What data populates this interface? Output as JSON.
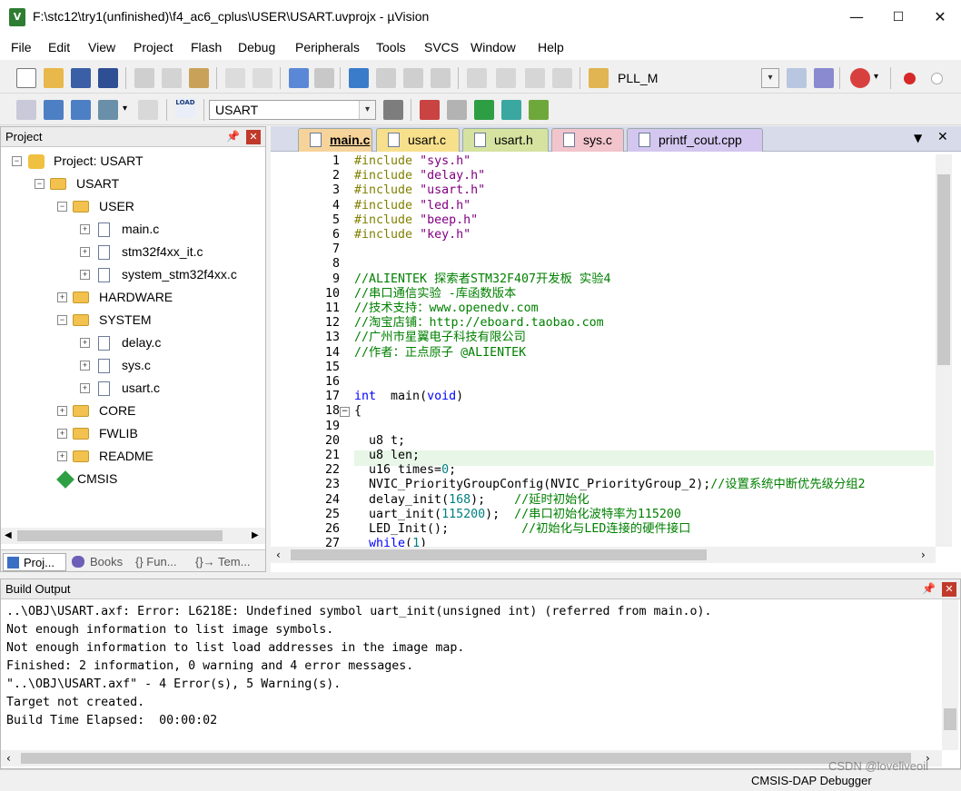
{
  "window": {
    "title": "F:\\stc12\\try1(unfinished)\\f4_ac6_cplus\\USER\\USART.uvprojx - µVision",
    "logo": "V"
  },
  "menu": [
    "File",
    "Edit",
    "View",
    "Project",
    "Flash",
    "Debug",
    "Peripherals",
    "Tools",
    "SVCS",
    "Window",
    "Help"
  ],
  "toolbar1": {
    "target_label": "PLL_M"
  },
  "toolbar2": {
    "target_select": "USART",
    "load_label": "LOAD"
  },
  "project_panel": {
    "title": "Project",
    "tree": [
      {
        "label": "Project: USART",
        "depth": 0,
        "kind": "root",
        "exp": "−"
      },
      {
        "label": "USART",
        "depth": 1,
        "kind": "target",
        "exp": "−"
      },
      {
        "label": "USER",
        "depth": 2,
        "kind": "folder",
        "exp": "−"
      },
      {
        "label": "main.c",
        "depth": 3,
        "kind": "file",
        "exp": "+"
      },
      {
        "label": "stm32f4xx_it.c",
        "depth": 3,
        "kind": "file",
        "exp": "+"
      },
      {
        "label": "system_stm32f4xx.c",
        "depth": 3,
        "kind": "file",
        "exp": "+"
      },
      {
        "label": "HARDWARE",
        "depth": 2,
        "kind": "folder",
        "exp": "+"
      },
      {
        "label": "SYSTEM",
        "depth": 2,
        "kind": "folder",
        "exp": "−"
      },
      {
        "label": "delay.c",
        "depth": 3,
        "kind": "file",
        "exp": "+"
      },
      {
        "label": "sys.c",
        "depth": 3,
        "kind": "file",
        "exp": "+"
      },
      {
        "label": "usart.c",
        "depth": 3,
        "kind": "file",
        "exp": "+"
      },
      {
        "label": "CORE",
        "depth": 2,
        "kind": "folder",
        "exp": "+"
      },
      {
        "label": "FWLIB",
        "depth": 2,
        "kind": "folder",
        "exp": "+"
      },
      {
        "label": "README",
        "depth": 2,
        "kind": "folder",
        "exp": "+"
      },
      {
        "label": "CMSIS",
        "depth": 2,
        "kind": "gem",
        "exp": ""
      }
    ],
    "tabs": [
      "Proj...",
      "Books",
      "{} Fun...",
      "{}→ Tem..."
    ]
  },
  "editor": {
    "tabs": [
      {
        "label": "main.c",
        "active": true,
        "color": "#f5c98a"
      },
      {
        "label": "usart.c",
        "active": false,
        "color": "#f7e08c"
      },
      {
        "label": "usart.h",
        "active": false,
        "color": "#d6e2a0"
      },
      {
        "label": "sys.c",
        "active": false,
        "color": "#f2c4cc"
      },
      {
        "label": "printf_cout.cpp",
        "active": false,
        "color": "#d3c6ef"
      }
    ],
    "line_numbers": [
      "1",
      "2",
      "3",
      "4",
      "5",
      "6",
      "7",
      "8",
      "9",
      "10",
      "11",
      "12",
      "13",
      "14",
      "15",
      "16",
      "17",
      "18",
      "19",
      "20",
      "21",
      "22",
      "23",
      "24",
      "25",
      "26",
      "27"
    ],
    "lines": [
      [
        [
          "pp",
          "#include "
        ],
        [
          "str",
          "\"sys.h\""
        ]
      ],
      [
        [
          "pp",
          "#include "
        ],
        [
          "str",
          "\"delay.h\""
        ]
      ],
      [
        [
          "pp",
          "#include "
        ],
        [
          "str",
          "\"usart.h\""
        ]
      ],
      [
        [
          "pp",
          "#include "
        ],
        [
          "str",
          "\"led.h\""
        ]
      ],
      [
        [
          "pp",
          "#include "
        ],
        [
          "str",
          "\"beep.h\""
        ]
      ],
      [
        [
          "pp",
          "#include "
        ],
        [
          "str",
          "\"key.h\""
        ]
      ],
      [],
      [],
      [
        [
          "cm",
          "//ALIENTEK 探索者STM32F407开发板 实验4"
        ]
      ],
      [
        [
          "cm",
          "//串口通信实验 -库函数版本"
        ]
      ],
      [
        [
          "cm",
          "//技术支持：www.openedv.com"
        ]
      ],
      [
        [
          "cm",
          "//淘宝店铺：http://eboard.taobao.com"
        ]
      ],
      [
        [
          "cm",
          "//广州市星翼电子科技有限公司"
        ]
      ],
      [
        [
          "cm",
          "//作者：正点原子 @ALIENTEK"
        ]
      ],
      [],
      [],
      [
        [
          "kw",
          "int"
        ],
        [
          "",
          "  main("
        ],
        [
          "kw",
          "void"
        ],
        [
          "",
          ")"
        ]
      ],
      [
        [
          "",
          "{"
        ]
      ],
      [],
      [
        [
          "",
          "  u8 t;"
        ]
      ],
      [
        [
          "",
          "  u8 len;"
        ]
      ],
      [
        [
          "",
          "  u16 times="
        ],
        [
          "num",
          "0"
        ],
        [
          "",
          ";"
        ]
      ],
      [
        [
          "",
          "  NVIC_PriorityGroupConfig(NVIC_PriorityGroup_2);"
        ],
        [
          "cm",
          "//设置系统中断优先级分组2"
        ]
      ],
      [
        [
          "",
          "  delay_init("
        ],
        [
          "num",
          "168"
        ],
        [
          "",
          ");    "
        ],
        [
          "cm",
          "//延时初始化"
        ]
      ],
      [
        [
          "",
          "  uart_init("
        ],
        [
          "num",
          "115200"
        ],
        [
          "",
          ");  "
        ],
        [
          "cm",
          "//串口初始化波特率为115200"
        ]
      ],
      [
        [
          "",
          "  LED_Init();          "
        ],
        [
          "cm",
          "//初始化与LED连接的硬件接口"
        ]
      ],
      [
        [
          "kw",
          "  while"
        ],
        [
          "",
          "("
        ],
        [
          "num",
          "1"
        ],
        [
          "",
          ")"
        ]
      ]
    ]
  },
  "build_output": {
    "title": "Build Output",
    "lines": [
      "..\\OBJ\\USART.axf: Error: L6218E: Undefined symbol uart_init(unsigned int) (referred from main.o).",
      "Not enough information to list image symbols.",
      "Not enough information to list load addresses in the image map.",
      "Finished: 2 information, 0 warning and 4 error messages.",
      "\"..\\OBJ\\USART.axf\" - 4 Error(s), 5 Warning(s).",
      "Target not created.",
      "Build Time Elapsed:  00:00:02"
    ]
  },
  "status": {
    "debugger": "CMSIS-DAP Debugger",
    "watermark": "CSDN @loveliveoil"
  }
}
